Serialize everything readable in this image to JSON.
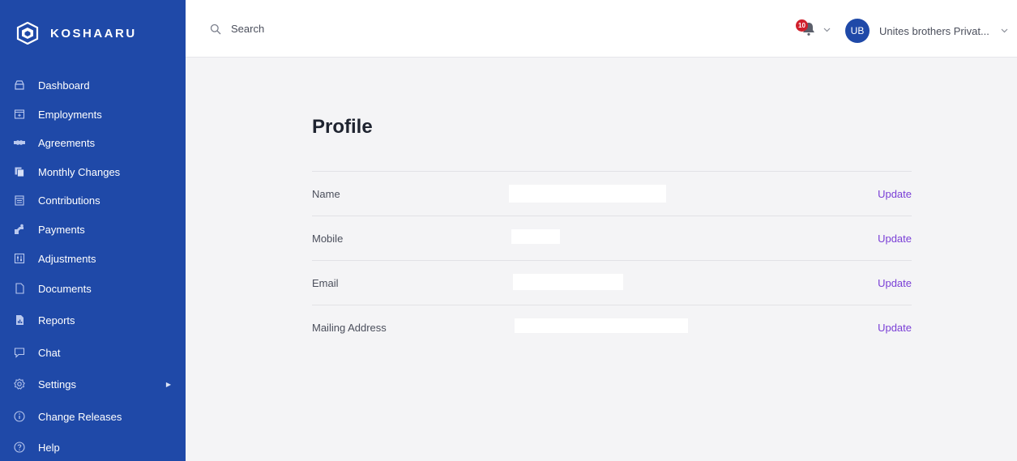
{
  "brand": {
    "name": "KOSHAARU"
  },
  "nav": [
    {
      "label": "Dashboard",
      "icon": "dashboard-icon"
    },
    {
      "label": "Employments",
      "icon": "employments-icon"
    },
    {
      "label": "Agreements",
      "icon": "handshake-icon"
    },
    {
      "label": "Monthly Changes",
      "icon": "copy-icon"
    },
    {
      "label": "Contributions",
      "icon": "calendar-icon"
    },
    {
      "label": "Payments",
      "icon": "payments-icon"
    },
    {
      "label": "Adjustments",
      "icon": "sliders-icon"
    },
    {
      "label": "Documents",
      "icon": "document-icon"
    },
    {
      "label": "Reports",
      "icon": "report-icon"
    },
    {
      "label": "Chat",
      "icon": "chat-icon"
    },
    {
      "label": "Settings",
      "icon": "gear-icon"
    },
    {
      "label": "Change Releases",
      "icon": "info-icon"
    },
    {
      "label": "Help",
      "icon": "help-icon"
    }
  ],
  "topbar": {
    "search_placeholder": "Search",
    "notification_count": "10",
    "account_initials": "UB",
    "account_name": "Unites brothers Privat..."
  },
  "profile": {
    "title": "Profile",
    "fields": [
      {
        "label": "Name",
        "action": "Update"
      },
      {
        "label": "Mobile",
        "action": "Update"
      },
      {
        "label": "Email",
        "action": "Update"
      },
      {
        "label": "Mailing Address",
        "action": "Update"
      }
    ]
  },
  "colors": {
    "sidebar": "#1f49a8",
    "accent": "#7a3fd6",
    "badge": "#d0202c"
  }
}
